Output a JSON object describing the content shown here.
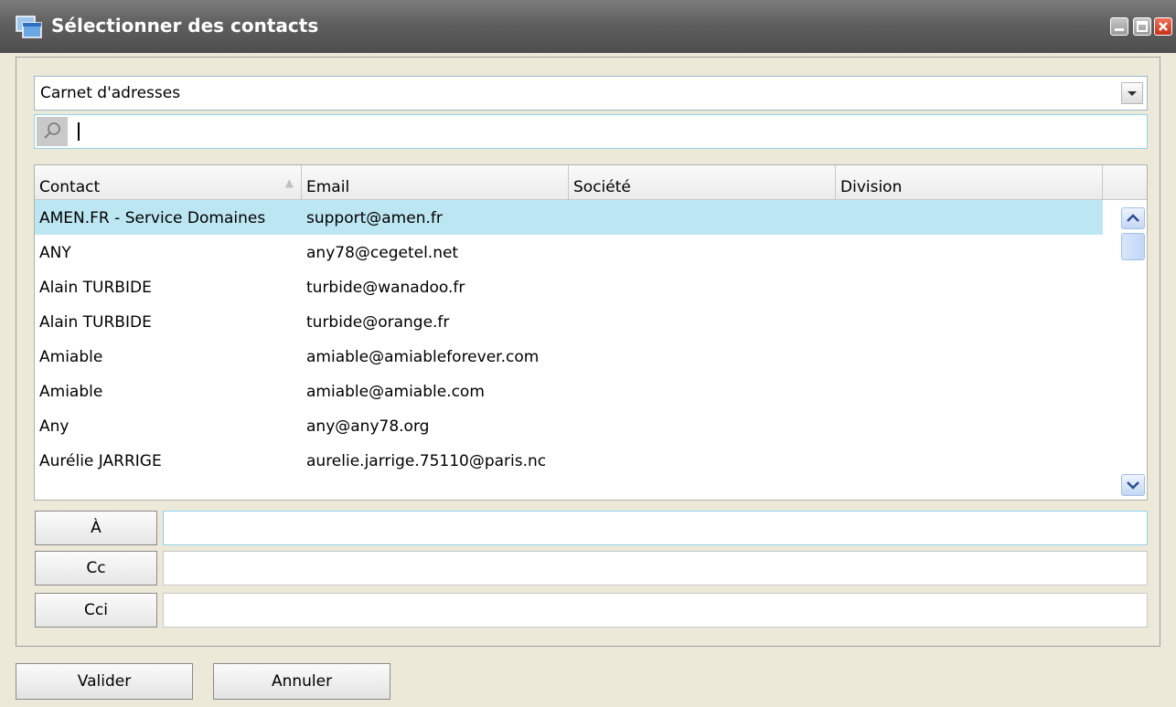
{
  "window": {
    "title": "Sélectionner des contacts"
  },
  "address_book": {
    "selected": "Carnet d'adresses"
  },
  "search": {
    "value": "",
    "placeholder": ""
  },
  "contacts_table": {
    "columns": [
      "Contact",
      "Email",
      "Société",
      "Division"
    ],
    "rows": [
      {
        "contact": "AMEN.FR - Service Domaines",
        "email": "support@amen.fr",
        "societe": "",
        "division": ""
      },
      {
        "contact": "ANY",
        "email": "any78@cegetel.net",
        "societe": "",
        "division": ""
      },
      {
        "contact": "Alain TURBIDE",
        "email": "turbide@wanadoo.fr",
        "societe": "",
        "division": ""
      },
      {
        "contact": "Alain TURBIDE",
        "email": "turbide@orange.fr",
        "societe": "",
        "division": ""
      },
      {
        "contact": "Amiable",
        "email": "amiable@amiableforever.com",
        "societe": "",
        "division": ""
      },
      {
        "contact": "Amiable",
        "email": "amiable@amiable.com",
        "societe": "",
        "division": ""
      },
      {
        "contact": "Any",
        "email": "any@any78.org",
        "societe": "",
        "division": ""
      },
      {
        "contact": "Aurélie JARRIGE",
        "email": "aurelie.jarrige.75110@paris.nc",
        "societe": "",
        "division": ""
      }
    ]
  },
  "recipients": {
    "to_label": "À",
    "cc_label": "Cc",
    "bcc_label": "Cci",
    "to_value": "",
    "cc_value": "",
    "bcc_value": ""
  },
  "actions": {
    "validate_label": "Valider",
    "cancel_label": "Annuler"
  },
  "colors": {
    "selection": "#bde6f3",
    "titlebar": "#5f5f5f",
    "background": "#ece9d8"
  }
}
